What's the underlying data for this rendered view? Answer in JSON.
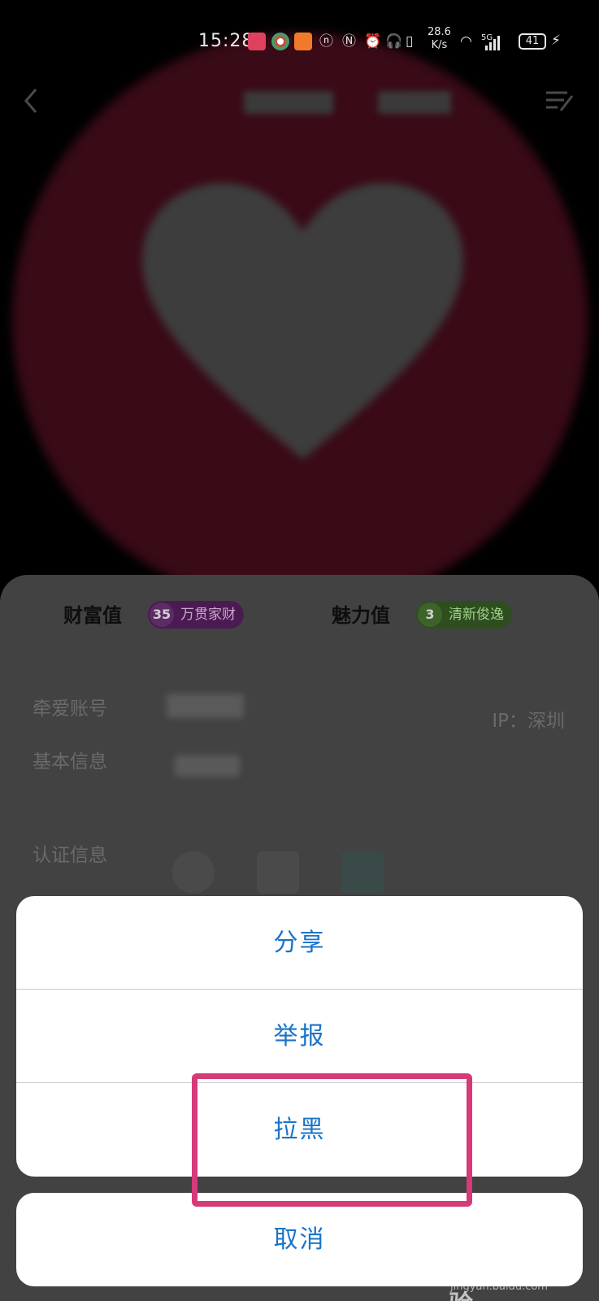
{
  "status_bar": {
    "time": "15:28",
    "net_speed_value": "28.6",
    "net_speed_unit": "K/s",
    "network_type": "5G",
    "battery": "41"
  },
  "profile": {
    "wealth_label": "财富值",
    "wealth_level": "35",
    "wealth_title": "万贯家财",
    "charm_label": "魅力值",
    "charm_level": "3",
    "charm_title": "清新俊逸",
    "account_label": "牵爱账号",
    "ip_text": "IP：深圳",
    "basic_info_label": "基本信息",
    "cert_label": "认证信息"
  },
  "action_sheet": {
    "items": [
      {
        "label": "分享"
      },
      {
        "label": "举报"
      },
      {
        "label": "拉黑"
      }
    ],
    "cancel_label": "取消"
  },
  "watermark": {
    "logo": "Bai du 经验",
    "url": "jingyan.baidu.com"
  },
  "colors": {
    "action_text": "#1a73c9",
    "highlight": "#d63a78",
    "overlay": "#000000b3"
  }
}
